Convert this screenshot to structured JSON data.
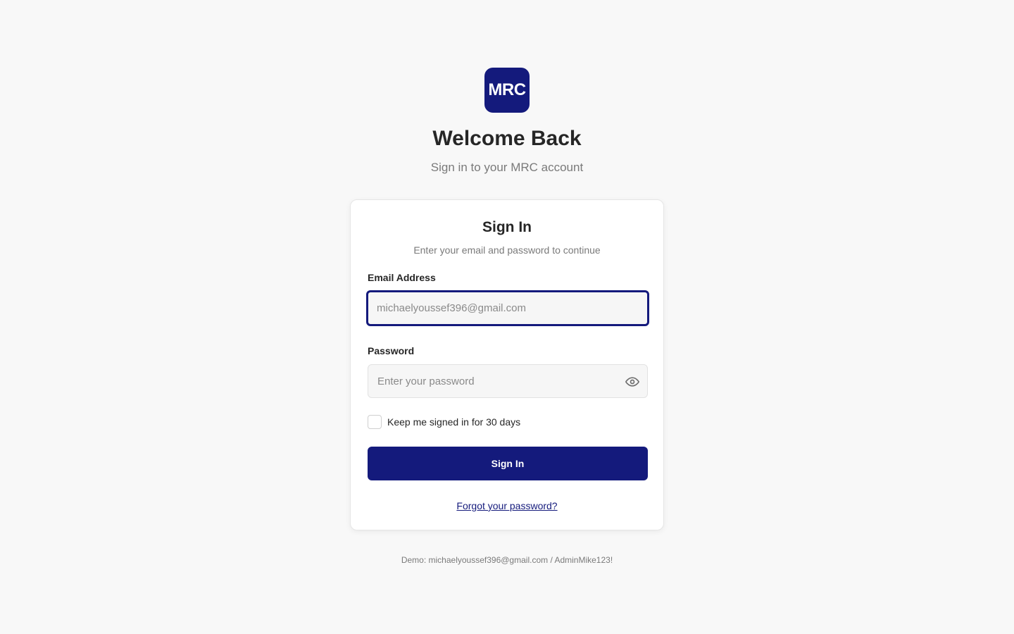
{
  "brand": {
    "logo_text": "MRC",
    "accent_color": "#141a7c"
  },
  "header": {
    "title": "Welcome Back",
    "subtitle": "Sign in to your MRC account"
  },
  "card": {
    "title": "Sign In",
    "subtitle": "Enter your email and password to continue",
    "email": {
      "label": "Email Address",
      "placeholder": "michaelyoussef396@gmail.com",
      "value": ""
    },
    "password": {
      "label": "Password",
      "placeholder": "Enter your password",
      "value": "",
      "toggle_icon": "eye-icon"
    },
    "remember": {
      "label": "Keep me signed in for 30 days",
      "checked": false
    },
    "submit_label": "Sign In",
    "forgot_label": "Forgot your password?"
  },
  "footer": {
    "demo_note": "Demo: michaelyoussef396@gmail.com / AdminMike123!"
  }
}
